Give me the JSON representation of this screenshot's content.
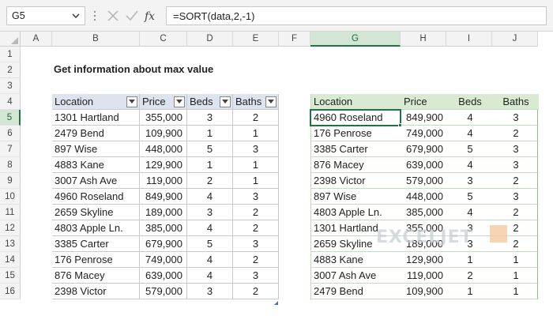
{
  "formula_bar": {
    "name_box": "G5",
    "formula": "=SORT(data,2,-1)",
    "cancel_icon": "cancel-x-icon",
    "enter_icon": "check-icon",
    "fx_icon": "fx-icon"
  },
  "columns": [
    "A",
    "B",
    "C",
    "D",
    "E",
    "F",
    "G",
    "H",
    "I",
    "J"
  ],
  "rows": [
    "1",
    "2",
    "3",
    "4",
    "5",
    "6",
    "7",
    "8",
    "9",
    "10",
    "11",
    "12",
    "13",
    "14",
    "15",
    "16"
  ],
  "selected_column": "G",
  "selected_row": "5",
  "sheet": {
    "title": "Get information about max value",
    "source_table": {
      "headers": [
        "Location",
        "Price",
        "Beds",
        "Baths"
      ],
      "rows": [
        [
          "1301 Hartland",
          "355,000",
          "3",
          "2"
        ],
        [
          "2479 Bend",
          "109,900",
          "1",
          "1"
        ],
        [
          "897 Wise",
          "448,000",
          "5",
          "3"
        ],
        [
          "4883 Kane",
          "129,900",
          "1",
          "1"
        ],
        [
          "3007 Ash Ave",
          "119,000",
          "2",
          "1"
        ],
        [
          "4960 Roseland",
          "849,900",
          "4",
          "3"
        ],
        [
          "2659 Skyline",
          "189,000",
          "3",
          "2"
        ],
        [
          "4803 Apple Ln.",
          "385,000",
          "4",
          "2"
        ],
        [
          "3385 Carter",
          "679,900",
          "5",
          "3"
        ],
        [
          "176 Penrose",
          "749,000",
          "4",
          "2"
        ],
        [
          "876 Macey",
          "639,000",
          "4",
          "3"
        ],
        [
          "2398 Victor",
          "579,000",
          "3",
          "2"
        ]
      ]
    },
    "sorted_table": {
      "headers": [
        "Location",
        "Price",
        "Beds",
        "Baths"
      ],
      "rows": [
        [
          "4960 Roseland",
          "849,900",
          "4",
          "3"
        ],
        [
          "176 Penrose",
          "749,000",
          "4",
          "2"
        ],
        [
          "3385 Carter",
          "679,900",
          "5",
          "3"
        ],
        [
          "876 Macey",
          "639,000",
          "4",
          "3"
        ],
        [
          "2398 Victor",
          "579,000",
          "3",
          "2"
        ],
        [
          "897 Wise",
          "448,000",
          "5",
          "3"
        ],
        [
          "4803 Apple Ln.",
          "385,000",
          "4",
          "2"
        ],
        [
          "1301 Hartland",
          "355,000",
          "3",
          "2"
        ],
        [
          "2659 Skyline",
          "189,000",
          "3",
          "2"
        ],
        [
          "4883 Kane",
          "129,900",
          "1",
          "1"
        ],
        [
          "3007 Ash Ave",
          "119,000",
          "2",
          "1"
        ],
        [
          "2479 Bend",
          "109,900",
          "1",
          "1"
        ]
      ]
    }
  },
  "watermark": "EXCELJET",
  "colors": {
    "accent_green": "#217346",
    "source_header": "#dde3ef",
    "sorted_header": "#d9ead3"
  }
}
